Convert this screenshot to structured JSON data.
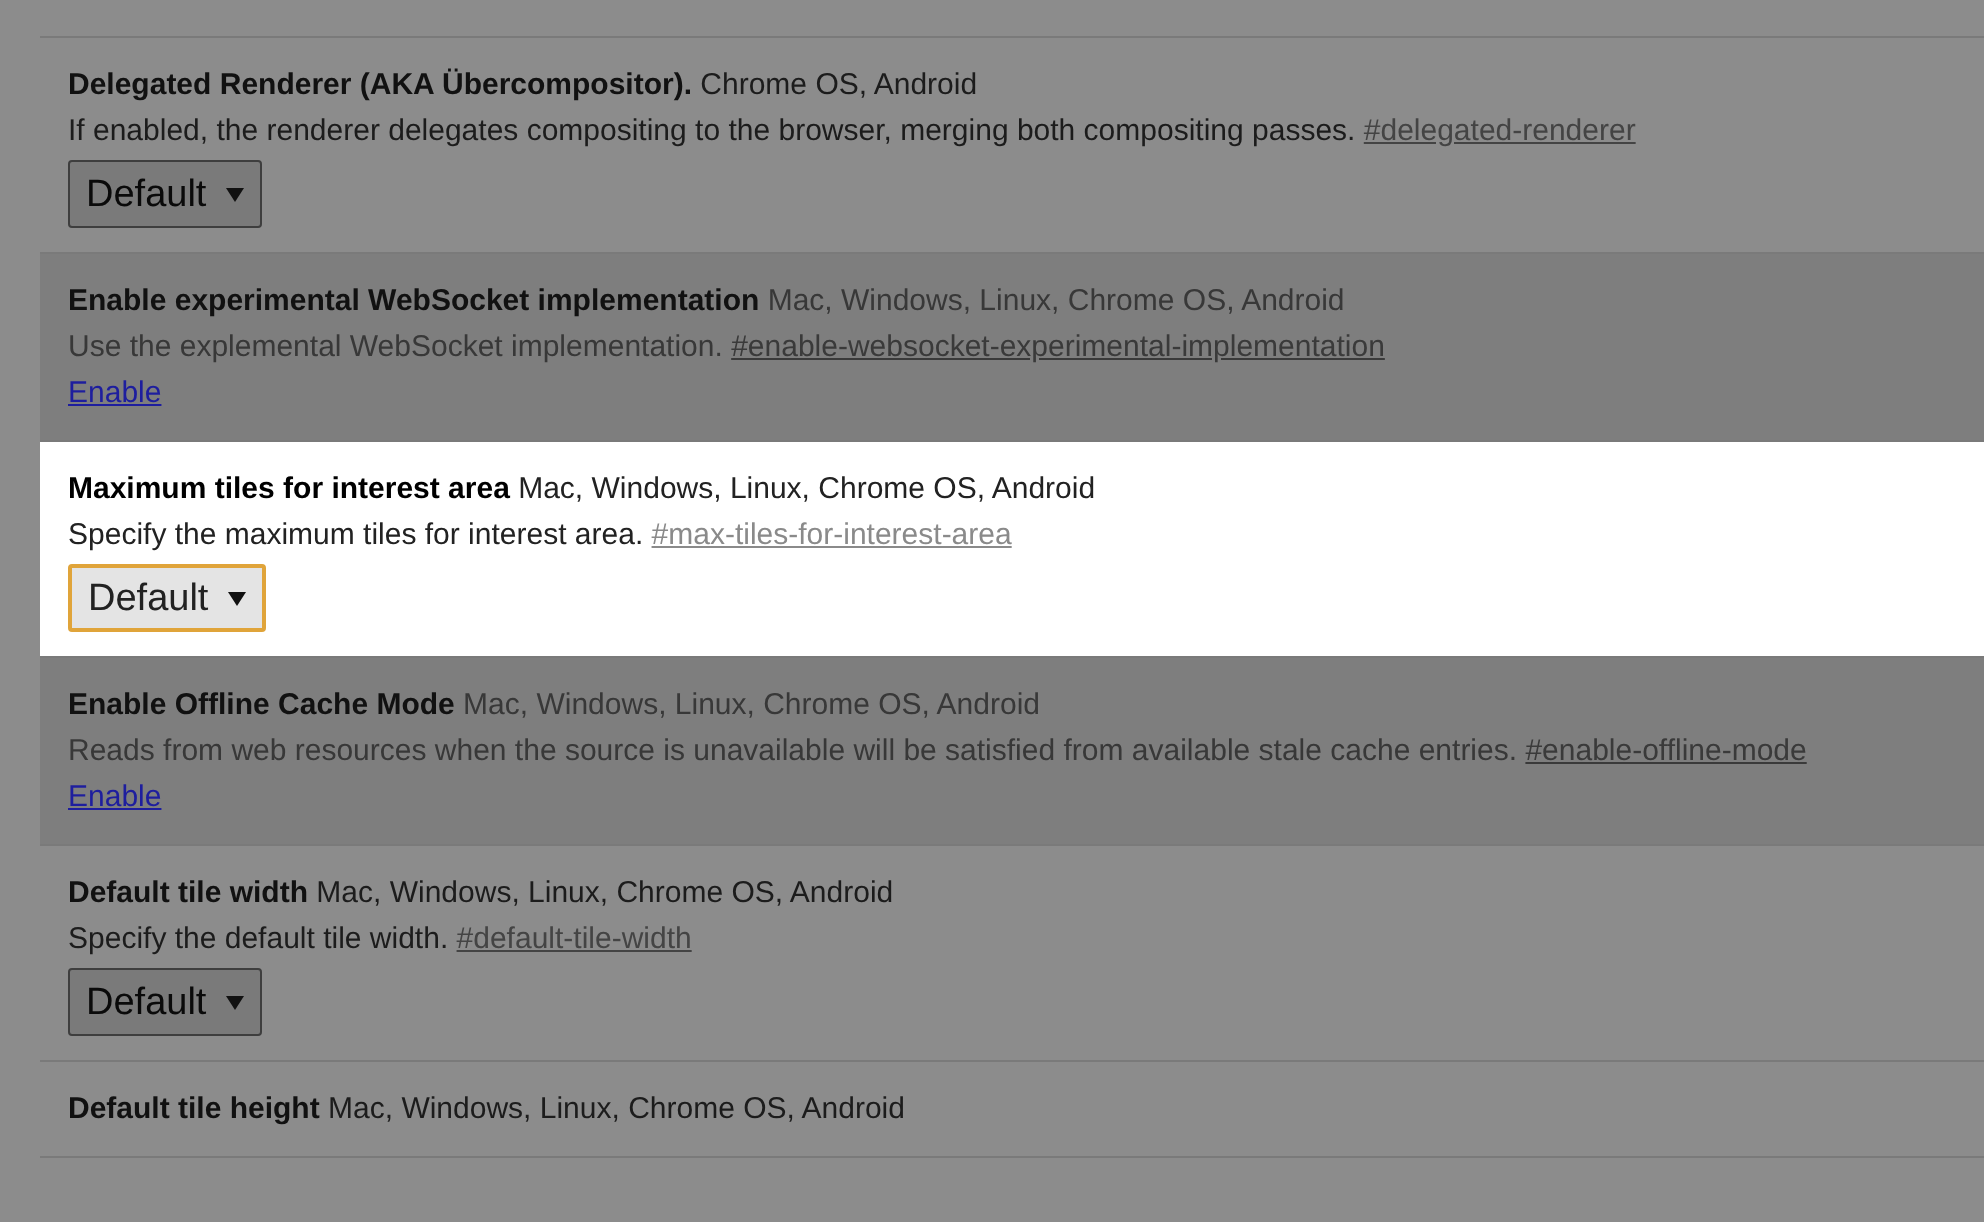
{
  "flags": [
    {
      "title": "Delegated Renderer (AKA Übercompositor).",
      "platforms": "Chrome OS, Android",
      "description": "If enabled, the renderer delegates compositing to the browser, merging both compositing passes.",
      "anchor": "#delegated-renderer",
      "control": {
        "kind": "select",
        "value": "Default"
      },
      "highlighted": false,
      "unsupported": false
    },
    {
      "title": "Enable experimental WebSocket implementation",
      "platforms": "Mac, Windows, Linux, Chrome OS, Android",
      "description": "Use the explemental WebSocket implementation.",
      "anchor": "#enable-websocket-experimental-implementation",
      "control": {
        "kind": "link",
        "label": "Enable"
      },
      "highlighted": false,
      "unsupported": true
    },
    {
      "title": "Maximum tiles for interest area",
      "platforms": "Mac, Windows, Linux, Chrome OS, Android",
      "description": "Specify the maximum tiles for interest area.",
      "anchor": "#max-tiles-for-interest-area",
      "control": {
        "kind": "select",
        "value": "Default"
      },
      "highlighted": true,
      "unsupported": false
    },
    {
      "title": "Enable Offline Cache Mode",
      "platforms": "Mac, Windows, Linux, Chrome OS, Android",
      "description": "Reads from web resources when the source is unavailable will be satisfied from available stale cache entries.",
      "anchor": "#enable-offline-mode",
      "control": {
        "kind": "link",
        "label": "Enable"
      },
      "highlighted": false,
      "unsupported": true
    },
    {
      "title": "Default tile width",
      "platforms": "Mac, Windows, Linux, Chrome OS, Android",
      "description": "Specify the default tile width.",
      "anchor": "#default-tile-width",
      "control": {
        "kind": "select",
        "value": "Default"
      },
      "highlighted": false,
      "unsupported": false
    },
    {
      "title": "Default tile height",
      "platforms": "Mac, Windows, Linux, Chrome OS, Android",
      "highlighted": false,
      "unsupported": false
    }
  ]
}
